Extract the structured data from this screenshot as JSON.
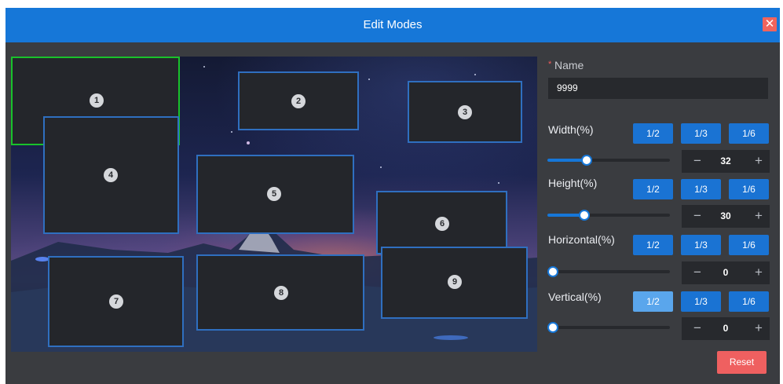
{
  "dialog": {
    "title": "Edit Modes",
    "close_icon": "close-icon"
  },
  "regions": [
    "1",
    "2",
    "3",
    "4",
    "5",
    "6",
    "7",
    "8",
    "9"
  ],
  "form": {
    "name_label": "Name",
    "required_mark": "*",
    "name_value": "9999",
    "width": {
      "label": "Width(%)",
      "value": "32",
      "presets": [
        "1/2",
        "1/3",
        "1/6"
      ],
      "minus": "−",
      "plus": "+"
    },
    "height": {
      "label": "Height(%)",
      "value": "30",
      "presets": [
        "1/2",
        "1/3",
        "1/6"
      ],
      "minus": "−",
      "plus": "+"
    },
    "horizontal": {
      "label": "Horizontal(%)",
      "value": "0",
      "presets": [
        "1/2",
        "1/3",
        "1/6"
      ],
      "minus": "−",
      "plus": "+"
    },
    "vertical": {
      "label": "Vertical(%)",
      "value": "0",
      "presets": [
        "1/2",
        "1/3",
        "1/6"
      ],
      "minus": "−",
      "plus": "+"
    },
    "reset_label": "Reset"
  },
  "colors": {
    "accent": "#1677d8",
    "reset": "#ef6060",
    "selected_region": "#19c22b",
    "region_border": "#2f6fc0"
  }
}
